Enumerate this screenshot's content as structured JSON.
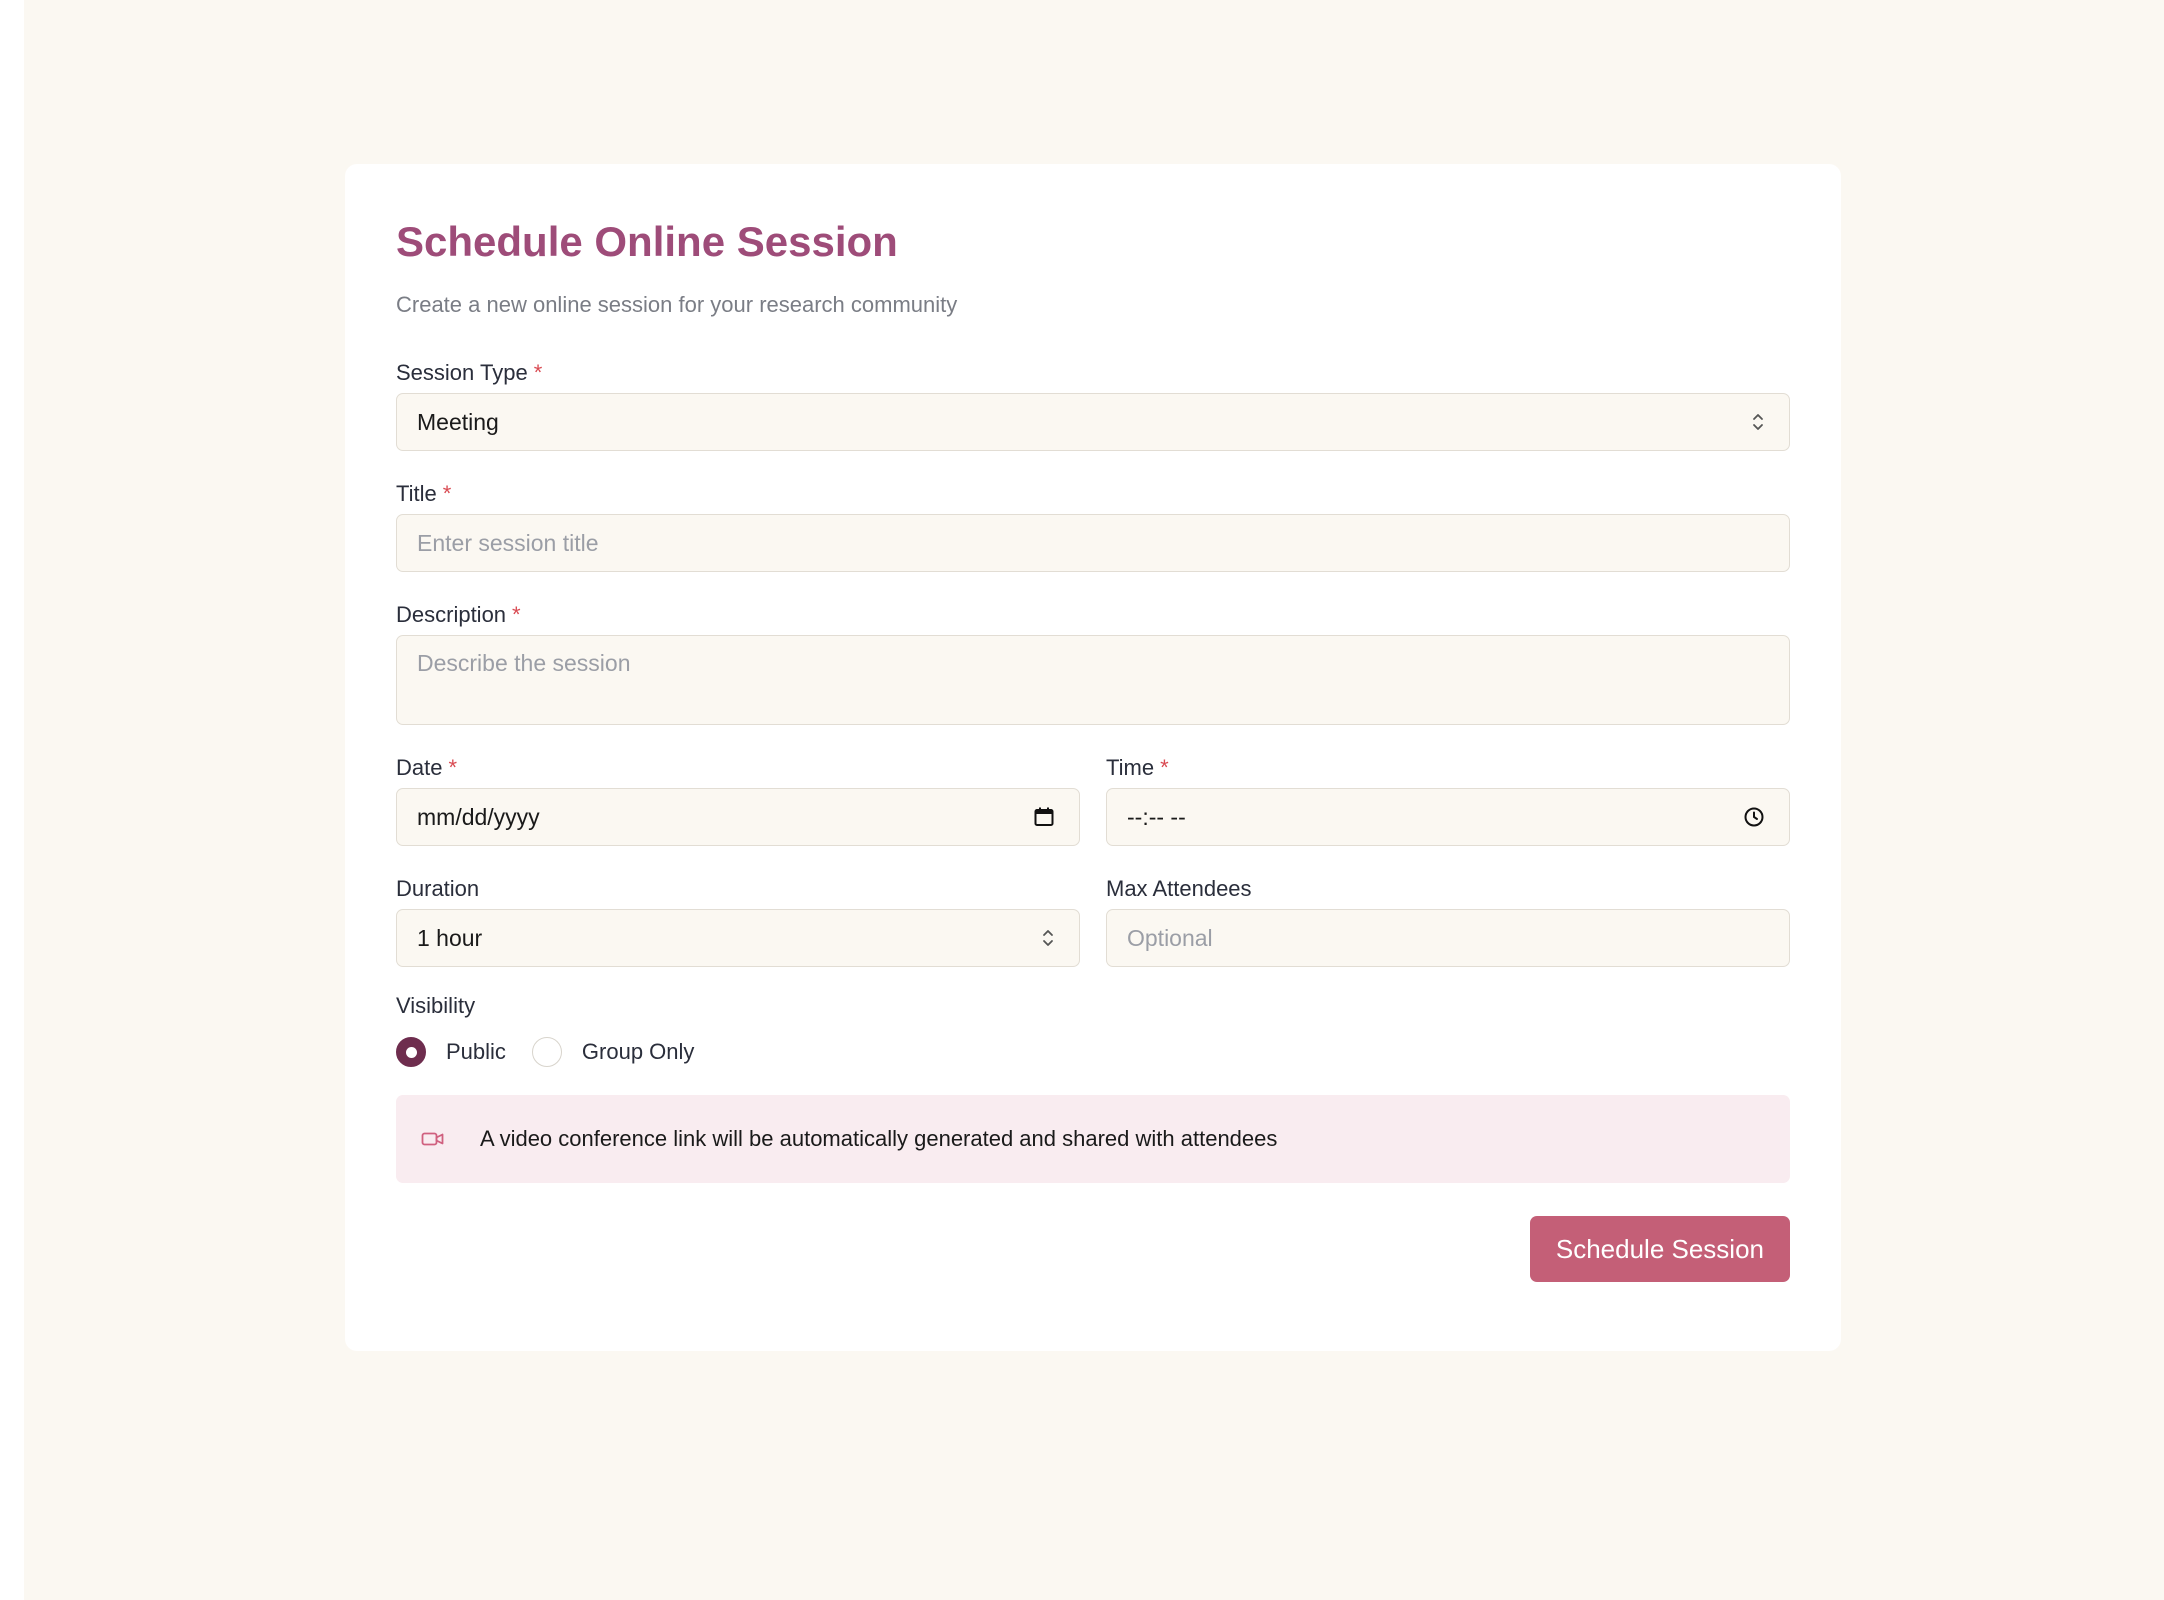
{
  "form": {
    "title": "Schedule Online Session",
    "subtitle": "Create a new online session for your research community",
    "required_marker": "*",
    "session_type": {
      "label": "Session Type",
      "value": "Meeting"
    },
    "title_field": {
      "label": "Title",
      "placeholder": "Enter session title"
    },
    "description": {
      "label": "Description",
      "placeholder": "Describe the session"
    },
    "date": {
      "label": "Date",
      "value": "mm/dd/yyyy"
    },
    "time": {
      "label": "Time",
      "value": "--:-- --"
    },
    "duration": {
      "label": "Duration",
      "value": "1 hour"
    },
    "max_attendees": {
      "label": "Max Attendees",
      "placeholder": "Optional"
    },
    "visibility": {
      "label": "Visibility",
      "options": [
        {
          "label": "Public",
          "checked": true
        },
        {
          "label": "Group Only",
          "checked": false
        }
      ]
    },
    "info_message": "A video conference link will be automatically generated and shared with attendees",
    "submit_label": "Schedule Session"
  },
  "colors": {
    "page_background": "#fbf8f2",
    "title": "#9e4c79",
    "required": "#d94a52",
    "radio_checked": "#6e2d4e",
    "info_background": "#f9ecf0",
    "info_icon": "#d0607f",
    "primary_button": "#c45f77"
  },
  "icons": {
    "select_chevron": "chevron-up-down-icon",
    "date": "calendar-icon",
    "time": "clock-icon",
    "info": "video-camera-icon"
  }
}
